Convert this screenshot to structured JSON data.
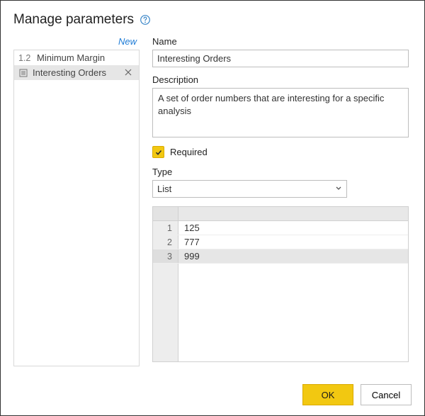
{
  "dialog": {
    "title": "Manage parameters",
    "new_label": "New"
  },
  "sidebar": {
    "items": [
      {
        "prefix": "1.2",
        "label": "Minimum Margin",
        "selected": false
      },
      {
        "prefix": "",
        "label": "Interesting Orders",
        "selected": true
      }
    ]
  },
  "form": {
    "name_label": "Name",
    "name_value": "Interesting Orders",
    "description_label": "Description",
    "description_value": "A set of order numbers that are interesting for a specific analysis",
    "required_label": "Required",
    "required_checked": true,
    "type_label": "Type",
    "type_value": "List"
  },
  "list_values": {
    "rows": [
      {
        "n": "1",
        "v": "125"
      },
      {
        "n": "2",
        "v": "777"
      },
      {
        "n": "3",
        "v": "999"
      }
    ]
  },
  "buttons": {
    "ok": "OK",
    "cancel": "Cancel"
  }
}
